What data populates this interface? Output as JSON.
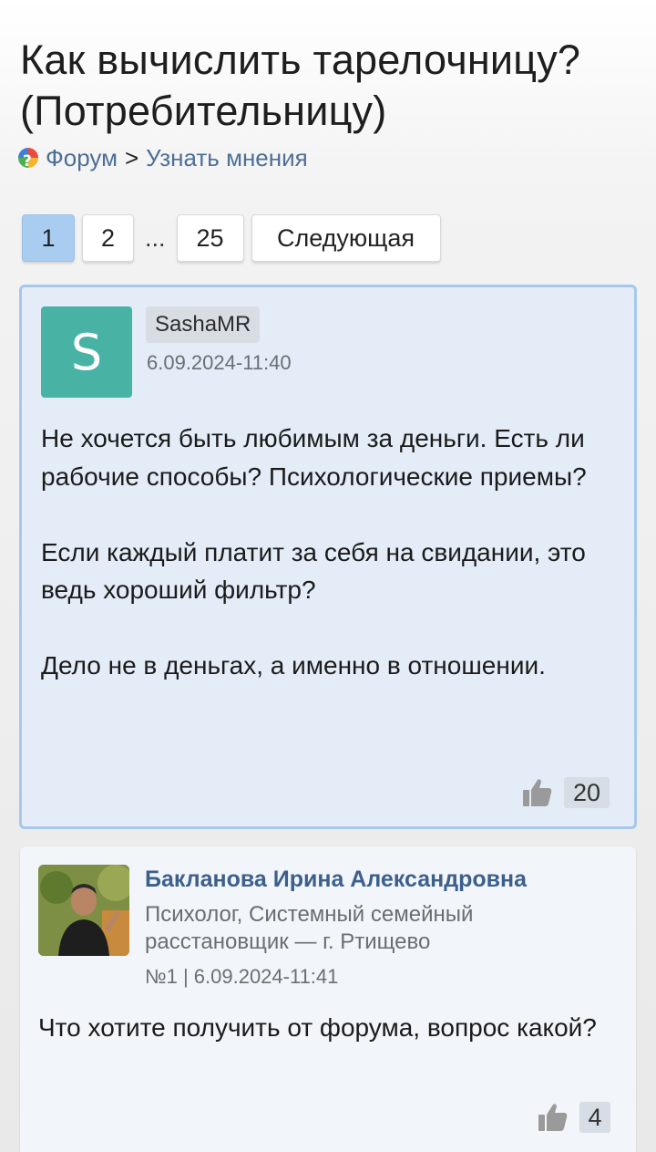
{
  "page": {
    "title": "Как вычислить тарелочницу? (Потребительницу)"
  },
  "breadcrumb": {
    "icon": "forum-question-icon",
    "items": [
      {
        "label": "Форум"
      },
      {
        "label": "Узнать мнения"
      }
    ],
    "separator": ">"
  },
  "pagination": {
    "pages": [
      "1",
      "2"
    ],
    "ellipsis": "...",
    "last_page": "25",
    "next_label": "Следующая",
    "active_page": "1"
  },
  "post": {
    "avatar_letter": "S",
    "avatar_color": "#48b3a5",
    "author": "SashaMR",
    "date": "6.09.2024-11:40",
    "paragraphs": [
      "Не хочется быть любимым за деньги. Есть ли рабочие способы? Психологические приемы?",
      "Если каждый платит за себя на свидании, это ведь хороший фильтр?",
      "Дело не в деньгах, а именно в отношении."
    ],
    "likes": "20"
  },
  "reply": {
    "author": "Бакланова Ирина Александровна",
    "role": "Психолог, Системный семейный расстановщик — г. Ртищево",
    "meta": "№1 | 6.09.2024-11:41",
    "body": "Что хотите получить от форума, вопрос какой?",
    "likes": "4"
  },
  "colors": {
    "accent_link": "#4d6f96",
    "post_background": "#e3ecf7",
    "post_border": "#a7c8ea",
    "active_page": "#a9cdf0"
  }
}
